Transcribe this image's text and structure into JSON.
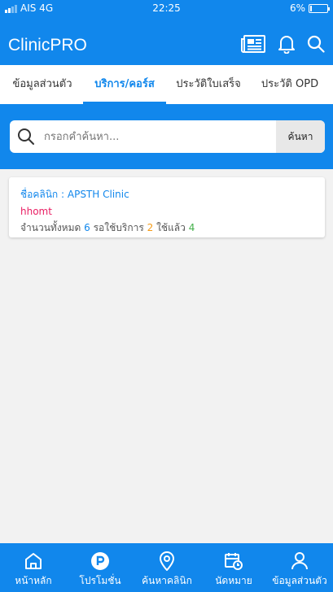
{
  "status_bar": {
    "carrier": "AIS 4G",
    "time": "22:25",
    "battery": "6%"
  },
  "app_bar": {
    "title": "ClinicPRO",
    "icons": [
      "newspaper-icon",
      "bell-icon",
      "search-icon"
    ]
  },
  "tabs": [
    {
      "label": "ข้อมูลส่วนตัว",
      "active": false
    },
    {
      "label": "บริการ/คอร์ส",
      "active": true
    },
    {
      "label": "ประวัติใบเสร็จ",
      "active": false
    },
    {
      "label": "ประวัติ OPD",
      "active": false
    }
  ],
  "search": {
    "placeholder": "กรอกคำค้นหา...",
    "value": "",
    "button_label": "ค้นหา"
  },
  "service_card": {
    "clinic_label": "ชื่อคลินิก : APSTH Clinic",
    "service_name": "hhomt",
    "total_label": "จำนวนทั้งหมด",
    "total": "6",
    "waiting_label": "รอใช้บริการ",
    "waiting": "2",
    "used_label": "ใช้แล้ว",
    "used": "4"
  },
  "bottom_nav": [
    {
      "label": "หน้าหลัก",
      "icon": "home-icon"
    },
    {
      "label": "โปรโมชั่น",
      "icon": "promotion-p-icon"
    },
    {
      "label": "ค้นหาคลินิก",
      "icon": "location-pin-icon"
    },
    {
      "label": "นัดหมาย",
      "icon": "calendar-clock-icon"
    },
    {
      "label": "ข้อมูลส่วนตัว",
      "icon": "user-icon"
    }
  ],
  "colors": {
    "primary": "#1187ec",
    "accent_pink": "#e91e63",
    "orange": "#f59b17",
    "green": "#43b04a"
  }
}
